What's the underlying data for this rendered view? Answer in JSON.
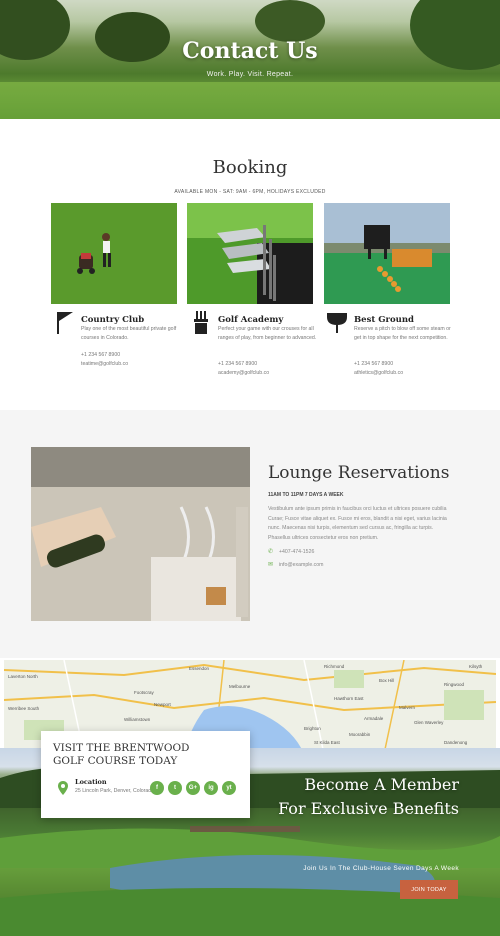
{
  "hero": {
    "title": "Contact Us",
    "subtitle": "Work. Play. Visit. Repeat."
  },
  "booking": {
    "title": "Booking",
    "hours": "AVAILABLE MON - SAT: 9AM - 6PM, HOLIDAYS EXCLUDED",
    "cards": [
      {
        "icon": "flag-icon",
        "title": "Country Club",
        "description": "Play one of the most beautiful private golf courses in Colorado.",
        "phone": "+1 234 567 8900",
        "email": "teatime@golfclub.co"
      },
      {
        "icon": "golf-bag-icon",
        "title": "Golf Academy",
        "description": "Perfect your game with our crouses for all ranges of play, from beginner to advanced.",
        "phone": "+1 234 567 8900",
        "email": "academy@golfclub.co"
      },
      {
        "icon": "golf-tee-icon",
        "title": "Best Ground",
        "description": "Reserve a pitch to blow off some steam or get in top shape for the next competition.",
        "phone": "+1 234 567 8900",
        "email": "athletics@golfclub.co"
      }
    ]
  },
  "lounge": {
    "title": "Lounge Reservations",
    "hours": "11AM TO 11PM 7 DAYS A WEEK",
    "description": "Vestibulum ante ipsum primis in faucibus orci luctus et ultrices posuere cubilia Curae; Fusce vitae aliquet ex. Fusce mi eros, blandit a nisi eget, varius lacinia nunc. Maecenas nisi turpis, elementum sed cursus ac, fringilla ac turpis. Phasellus ultrices consectetur eros non pretium.",
    "phone": "+407-474-1526",
    "email": "info@example.com"
  },
  "map": {
    "places": [
      "Laverton North",
      "Essendon",
      "Richmond",
      "Box Hill",
      "Ringwood",
      "Melbourne",
      "Footscray",
      "Williamstown",
      "Newport",
      "Brighton",
      "Moorabbin",
      "Hawthorn East",
      "Dandenong",
      "St Kilda East",
      "Glen Waverley",
      "Armadale",
      "Malvern",
      "Point Cook",
      "Werribee South",
      "Kilsyth"
    ]
  },
  "visit": {
    "title": "VISIT THE BRENTWOOD GOLF COURSE TODAY",
    "location_label": "Location",
    "address": "25 Lincoln Park, Denver, Colorado",
    "socials": [
      "f",
      "t",
      "G+",
      "ig",
      "yt"
    ]
  },
  "member": {
    "line1": "Become A Member",
    "line2": "For Exclusive Benefits",
    "join_text": "Join Us In The Club-House Seven Days A Week",
    "button": "JOIN TODAY"
  },
  "colors": {
    "accent_green": "#6ab04c",
    "button_orange": "#c7623f"
  }
}
